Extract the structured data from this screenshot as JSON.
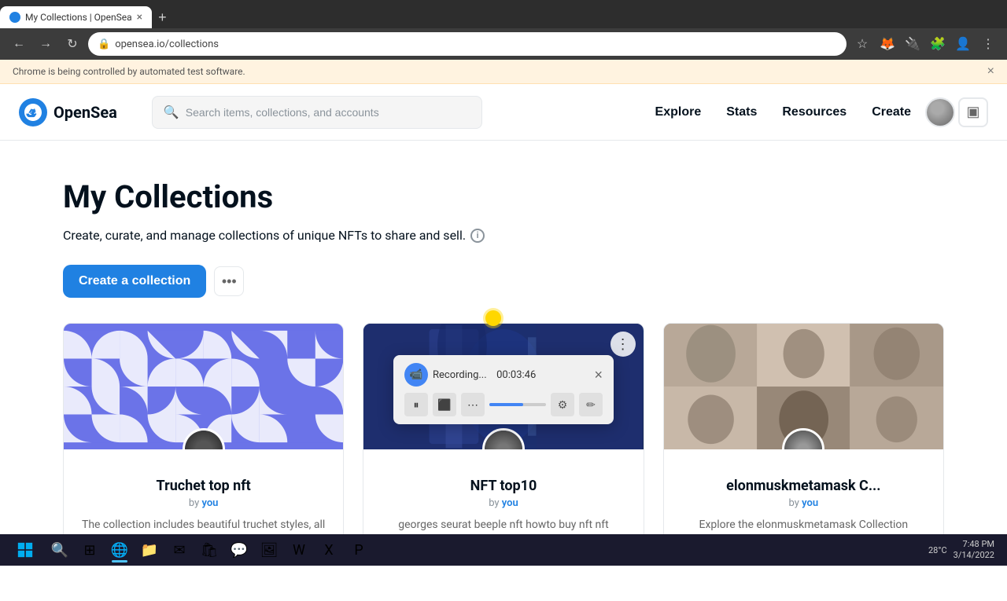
{
  "browser": {
    "tab_title": "My Collections | OpenSea",
    "tab_favicon_color": "#2081e2",
    "url": "opensea.io/collections",
    "automation_notice": "Chrome is being controlled by automated test software."
  },
  "header": {
    "logo_text": "OpenSea",
    "search_placeholder": "Search items, collections, and accounts",
    "nav": [
      "Explore",
      "Stats",
      "Resources",
      "Create"
    ]
  },
  "page": {
    "title": "My Collections",
    "subtitle": "Create, curate, and manage collections of unique NFTs to share and sell.",
    "create_button": "Create a collection",
    "more_dots": "⋯"
  },
  "collections": [
    {
      "name": "Truchet top nft",
      "by": "you",
      "description": "The collection includes beautiful truchet styles, all truchets are good for eyes relaxation and buzz",
      "banner_type": "truchet"
    },
    {
      "name": "NFT top10",
      "by": "you",
      "description": "georges seurat beeple nft howto buy nft nft meaning art nf",
      "banner_type": "nft"
    },
    {
      "name": "elonmuskmetamask C...",
      "by": "you",
      "description": "Explore the elonmuskmetamask Collection collection",
      "banner_type": "elon"
    }
  ],
  "recording": {
    "title": "Recording...",
    "time": "00:03:46",
    "close": "×"
  },
  "taskbar": {
    "time": "7:48 PM",
    "date": "3/14/2022",
    "temperature": "28°C"
  }
}
